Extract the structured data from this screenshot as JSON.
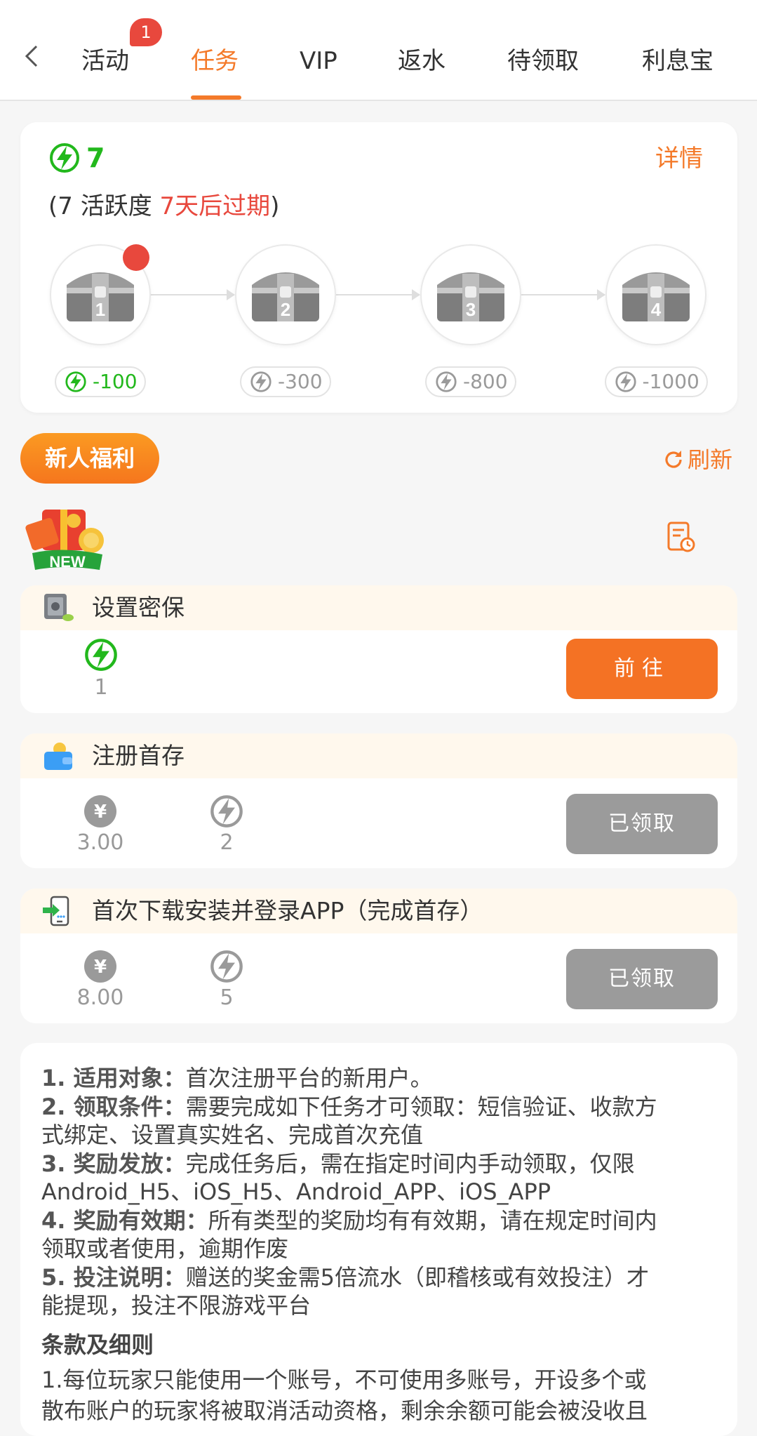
{
  "tabs": [
    {
      "label": "活动",
      "badge": "1"
    },
    {
      "label": "任务",
      "active": true
    },
    {
      "label": "VIP"
    },
    {
      "label": "返水"
    },
    {
      "label": "待领取"
    },
    {
      "label": "利息宝"
    }
  ],
  "activity": {
    "points": "7",
    "detail_label": "详情",
    "desc_prefix": "(7 活跃度 ",
    "desc_expire": "7天后过期",
    "desc_suffix": ")",
    "chests": [
      {
        "number": "1",
        "cost": "-100",
        "unlocked": true
      },
      {
        "number": "2",
        "cost": "-300",
        "unlocked": false
      },
      {
        "number": "3",
        "cost": "-800",
        "unlocked": false
      },
      {
        "number": "4",
        "cost": "-1000",
        "unlocked": false
      }
    ]
  },
  "section": {
    "badge_label": "新人福利",
    "refresh_label": "刷新",
    "new_label": "NEW"
  },
  "tasks": [
    {
      "title": "设置密保",
      "rewards": [
        {
          "type": "energy",
          "value": "1"
        }
      ],
      "button": "前往",
      "status": "go"
    },
    {
      "title": "注册首存",
      "rewards": [
        {
          "type": "yuan",
          "value": "3.00"
        },
        {
          "type": "energy",
          "value": "2"
        }
      ],
      "button": "已领取",
      "status": "done"
    },
    {
      "title": "首次下载安装并登录APP（完成首存）",
      "rewards": [
        {
          "type": "yuan",
          "value": "8.00"
        },
        {
          "type": "energy",
          "value": "5"
        }
      ],
      "button": "已领取",
      "status": "done"
    }
  ],
  "rules": {
    "items": [
      {
        "head": "1. 适用对象：",
        "text": "首次注册平台的新用户。"
      },
      {
        "head": "2. 领取条件：",
        "text": "需要完成如下任务才可领取：短信验证、收款方"
      },
      {
        "head": "",
        "text": "式绑定、设置真实姓名、完成首次充值"
      },
      {
        "head": "3. 奖励发放：",
        "text": "完成任务后，需在指定时间内手动领取，仅限"
      },
      {
        "head": "",
        "text": "Android_H5、iOS_H5、Android_APP、iOS_APP"
      },
      {
        "head": "4. 奖励有效期：",
        "text": "所有类型的奖励均有有效期，请在规定时间内"
      },
      {
        "head": "",
        "text": "领取或者使用，逾期作废"
      },
      {
        "head": "5. 投注说明：",
        "text": "赠送的奖金需5倍流水（即稽核或有效投注）才"
      },
      {
        "head": "",
        "text": "能提现，投注不限游戏平台"
      }
    ],
    "terms_title": "条款及细则",
    "terms_lines": [
      "1.每位玩家只能使用一个账号，不可使用多账号，开设多个或",
      "散布账户的玩家将被取消活动资格，剩余余额可能会被没收且"
    ]
  },
  "colors": {
    "accent": "#f47a2a",
    "green": "#22b81c",
    "red": "#e8483d",
    "grey_button": "#9b9b9b"
  }
}
